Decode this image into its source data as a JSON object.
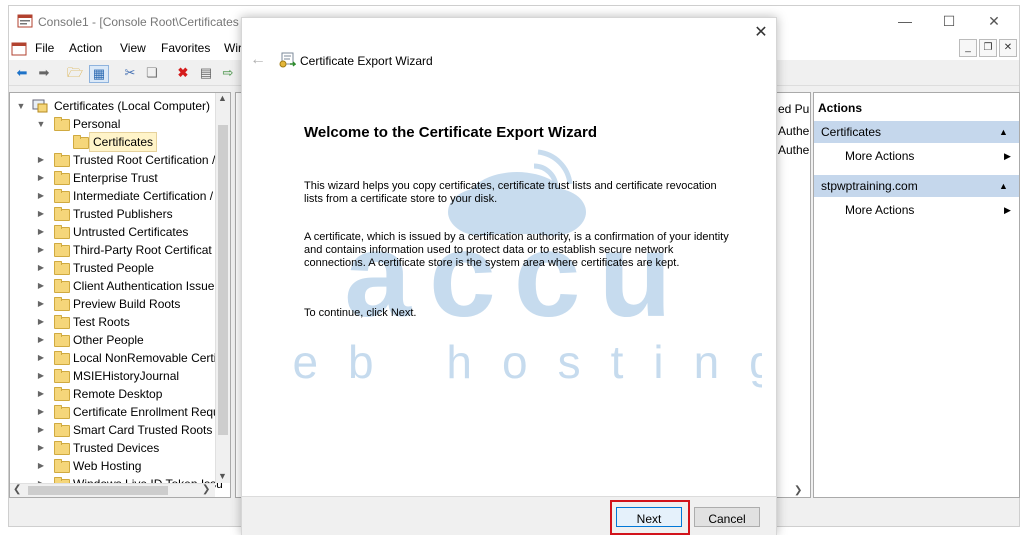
{
  "window": {
    "title": "Console1 - [Console Root\\Certificates (",
    "controls": [
      "minimize-icon",
      "maximize-icon",
      "close-icon"
    ]
  },
  "menu": [
    "File",
    "Action",
    "View",
    "Favorites",
    "Wir"
  ],
  "tree": {
    "root": "Certificates (Local Computer)",
    "personal": "Personal",
    "selected": "Certificates",
    "items": [
      "Trusted Root Certification /",
      "Enterprise Trust",
      "Intermediate Certification /",
      "Trusted Publishers",
      "Untrusted Certificates",
      "Third-Party Root Certificat",
      "Trusted People",
      "Client Authentication Issue",
      "Preview Build Roots",
      "Test Roots",
      "Other People",
      "Local NonRemovable Certi",
      "MSIEHistoryJournal",
      "Remote Desktop",
      "Certificate Enrollment Requ",
      "Smart Card Trusted Roots",
      "Trusted Devices",
      "Web Hosting",
      "Windows Live ID Token Issu"
    ]
  },
  "center": {
    "column_header_fragment": "ed Pu",
    "cells": [
      "Authe",
      "Authe"
    ]
  },
  "actions": {
    "header": "Actions",
    "sections": [
      {
        "title": "Certificates",
        "item": "More Actions"
      },
      {
        "title": "stpwptraining.com",
        "item": "More Actions"
      }
    ]
  },
  "watermark": {
    "brand": "accu",
    "tagline": "web hosting",
    "color": "#b9d3ea"
  },
  "wizard": {
    "title": "Certificate Export Wizard",
    "heading": "Welcome to the Certificate Export Wizard",
    "paragraph1": "This wizard helps you copy certificates, certificate trust lists and certificate revocation lists from a certificate store to your disk.",
    "paragraph2": "A certificate, which is issued by a certification authority, is a confirmation of your identity and contains information used to protect data or to establish secure network connections. A certificate store is the system area where certificates are kept.",
    "paragraph3": "To continue, click Next.",
    "next_label": "Next",
    "cancel_label": "Cancel",
    "highlight_color": "#d2131b"
  }
}
